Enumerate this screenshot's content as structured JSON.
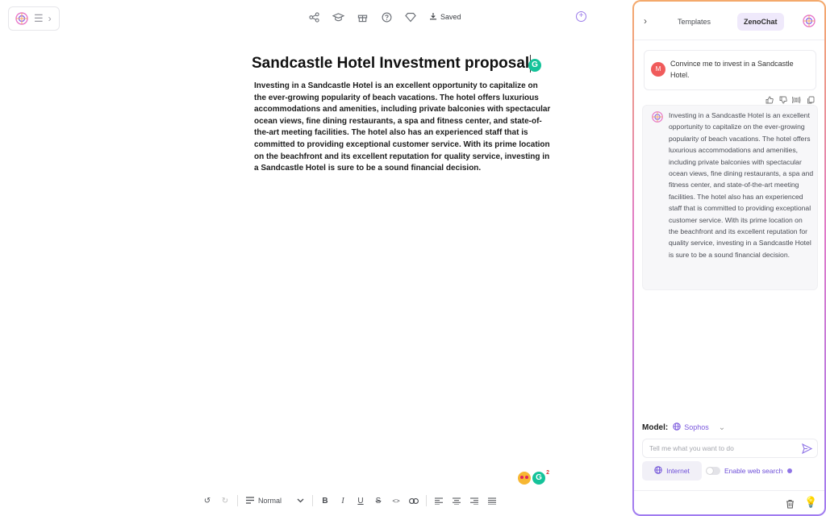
{
  "top_bar": {
    "saved_label": "Saved",
    "icons": [
      "share-icon",
      "graduation-cap-icon",
      "gift-icon",
      "help-icon",
      "diamond-icon",
      "download-icon"
    ]
  },
  "document": {
    "title": "Sandcastle Hotel Investment proposal",
    "grammarly_letter": "G",
    "body": "Investing in a Sandcastle Hotel is an excellent opportunity to capitalize on the ever-growing popularity of beach vacations. The hotel offers luxurious accommodations and amenities, including private balconies with spectacular ocean views, fine dining restaurants, a spa and fitness center, and state-of-the-art meeting facilities. The hotel also has an experienced staff that is committed to providing exceptional customer service. With its prime location on the beachfront and its excellent reputation for quality service, investing in a Sandcastle Hotel is sure to be a sound financial decision.",
    "grammarly_count": "2"
  },
  "format_bar": {
    "style_select": "Normal",
    "bold": "B",
    "italic": "I",
    "underline": "U",
    "strike": "S",
    "code": "<>"
  },
  "panel": {
    "tabs": [
      {
        "label": "Templates",
        "active": false
      },
      {
        "label": "ZenoChat",
        "active": true
      }
    ],
    "user_message": {
      "avatar_letter": "M",
      "text": "Convince me to invest in a Sandcastle Hotel."
    },
    "bot_message": {
      "text": "Investing in a Sandcastle Hotel is an excellent opportunity to capitalize on the ever-growing popularity of beach vacations. The hotel offers luxurious accommodations and amenities, including private balconies with spectacular ocean views, fine dining restaurants, a spa and fitness center, and state-of-the-art meeting facilities. The hotel also has an experienced staff that is committed to providing exceptional customer service. With its prime location on the beachfront and its excellent reputation for quality service, investing in a Sandcastle Hotel is sure to be a sound financial decision."
    },
    "model_label": "Model:",
    "model_value": "Sophos",
    "input_placeholder": "Tell me what you want to do",
    "internet_label": "Internet",
    "web_search_label": "Enable web search",
    "web_search_enabled": false
  },
  "colors": {
    "accent": "#7a57dd",
    "grammarly": "#15c39a",
    "avatar": "#f05b5b"
  }
}
